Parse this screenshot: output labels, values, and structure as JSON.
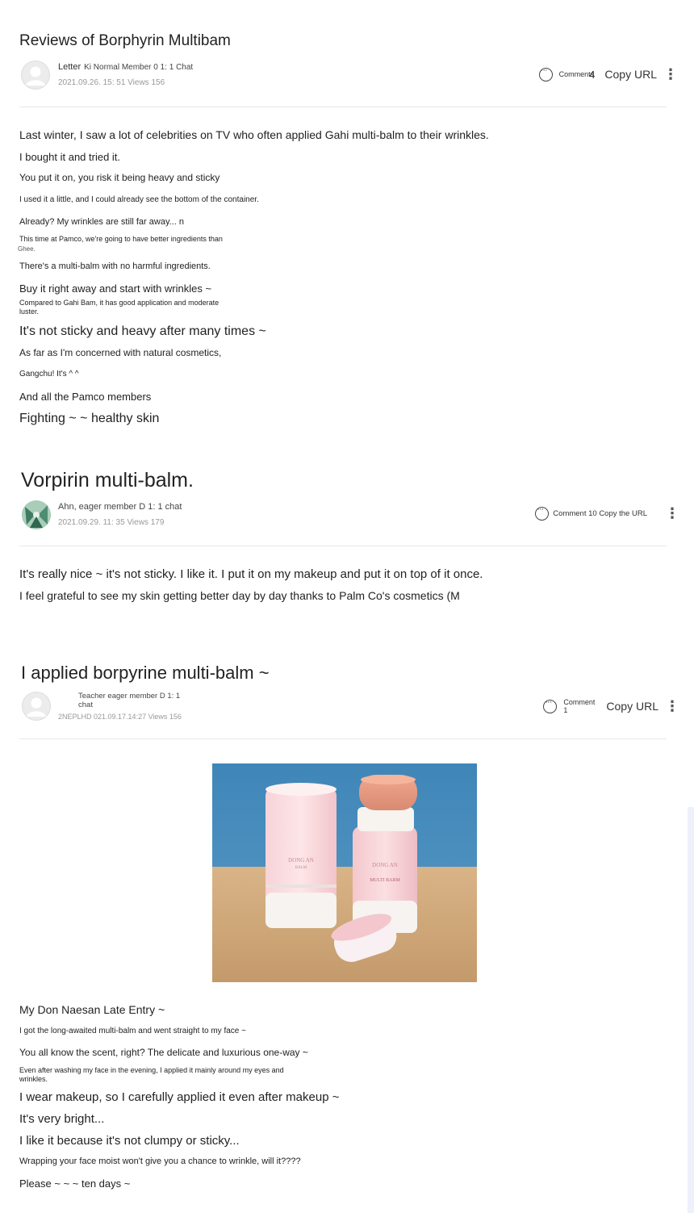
{
  "posts": [
    {
      "title": "Reviews of Borphyrin Multibam",
      "author_nick": "Letter",
      "author_info": "Ki Normal Member 0 1: 1 Chat",
      "dateline": "2021.09.26. 15: 51 Views 156",
      "comment_label": "Comments",
      "comment_count": "4",
      "copy_url": "Copy URL",
      "lines": [
        "Last winter, I saw a lot of celebrities on TV who often applied Gahi multi-balm to their wrinkles.",
        "I bought it and tried it.",
        "You put it on, you risk it being heavy and sticky",
        "I used it a little, and I could already see the bottom of the container.",
        "Already? My wrinkles are still far away... n",
        "This time at Pamco, we're going to have better ingredients than",
        "Ghee.",
        "There's a multi-balm with no harmful ingredients.",
        "Buy it right away and start with wrinkles ~",
        "Compared to Gahi Bam, it has good application and moderate",
        "luster.",
        "It's not sticky and heavy after many times ~",
        "As far as I'm concerned with natural cosmetics,",
        "Gangchu! It's ^ ^",
        "And all the Pamco members",
        "Fighting ~ ~ healthy skin"
      ]
    },
    {
      "title": "Vorpirin multi-balm.",
      "author_info": "Ahn, eager member D 1: 1 chat",
      "dateline": "2021.09.29. 11: 35 Views 179",
      "comment_text": "Comment 10 Copy the URL",
      "lines": [
        "It's really nice ~ it's not sticky. I like it. I put it on my makeup and put it on top of it once.",
        "I feel grateful to see my skin getting better day by day thanks to Palm Co's cosmetics (M"
      ]
    },
    {
      "title": "I applied borpyrine multi-balm ~",
      "author_info": "Teacher eager member D 1: 1 chat",
      "dateline": "2NEPLHD 021.09.17.14:27 Views 156",
      "comment_label": "Comment",
      "comment_count": "1",
      "copy_url": "Copy URL",
      "photo_alt": "DONG AN MULTI BALM",
      "lines": [
        "My Don Naesan Late Entry ~",
        "I got the long-awaited multi-balm and went straight to my face ~",
        "You all know the scent, right? The delicate and luxurious one-way ~",
        "Even after washing my face in the evening, I applied it mainly around my eyes and",
        "wrinkles.",
        "I wear makeup, so I carefully applied it even after makeup ~",
        "It's very bright...",
        "I like it because it's not clumpy or sticky...",
        "Wrapping your face moist won't give you a chance to wrinkle, will it????",
        "Please ~ ~ ~ ten days ~"
      ]
    }
  ],
  "icons": [
    "comment-icon",
    "kebab-menu-icon",
    "default-avatar-icon"
  ]
}
